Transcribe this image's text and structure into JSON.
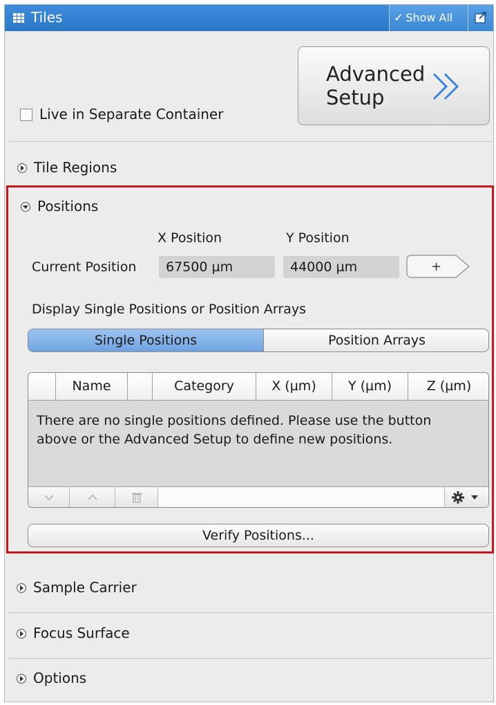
{
  "window": {
    "title": "Tiles",
    "show_all_label": "Show All"
  },
  "advanced_setup": {
    "label_line1": "Advanced",
    "label_line2": "Setup"
  },
  "live_container": {
    "label": "Live in Separate Container",
    "checked": false
  },
  "sections": {
    "tile_regions": "Tile Regions",
    "positions": "Positions",
    "sample_carrier": "Sample Carrier",
    "focus_surface": "Focus Surface",
    "options": "Options"
  },
  "positions": {
    "x_header": "X Position",
    "y_header": "Y Position",
    "current_label": "Current Position",
    "current_x": "67500 µm",
    "current_y": "44000 µm",
    "add_label": "+",
    "display_label": "Display Single Positions or Position Arrays",
    "toggle": {
      "single": "Single Positions",
      "arrays": "Position Arrays",
      "selected": "Single Positions"
    },
    "table": {
      "columns": [
        "Name",
        "Category",
        "X (µm)",
        "Y (µm)",
        "Z (µm)"
      ],
      "empty_message": "There are no single positions defined. Please use the button above or the Advanced Setup to define new positions."
    },
    "verify_label": "Verify Positions..."
  }
}
